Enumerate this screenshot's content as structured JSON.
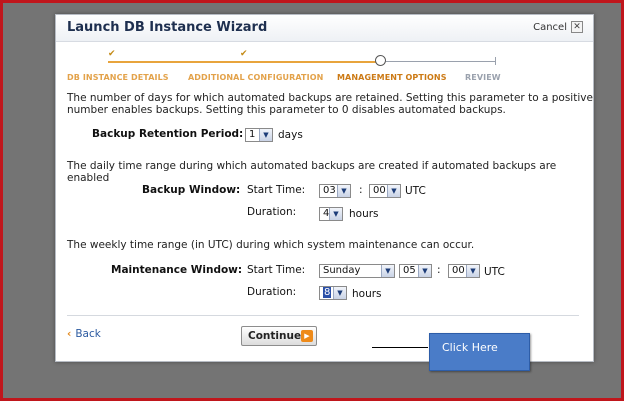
{
  "dialog": {
    "title": "Launch DB Instance Wizard",
    "cancel_label": "Cancel",
    "close_glyph": "✕"
  },
  "steps": [
    {
      "label": "DB INSTANCE DETAILS",
      "state": "done",
      "mark": "✔"
    },
    {
      "label": "ADDITIONAL CONFIGURATION",
      "state": "done",
      "mark": "✔"
    },
    {
      "label": "MANAGEMENT OPTIONS",
      "state": "current"
    },
    {
      "label": "REVIEW",
      "state": "future"
    }
  ],
  "backup": {
    "description_line1": "The number of days for which automated backups are retained. Setting this parameter to a positive",
    "description_line2": "number enables backups. Setting this parameter to 0 disables automated backups.",
    "retention_label": "Backup Retention Period:",
    "retention_value": "1",
    "retention_unit": "days"
  },
  "backup_window": {
    "description": "The daily time range during which automated backups are created if automated backups are enabled",
    "label": "Backup Window:",
    "start_label": "Start Time:",
    "start_hour": "03",
    "colon": ":",
    "start_minute": "00",
    "tz": "UTC",
    "duration_label": "Duration:",
    "duration_value": "4",
    "duration_unit": "hours"
  },
  "maintenance_window": {
    "description": "The weekly time range (in UTC) during which system maintenance can occur.",
    "label": "Maintenance Window:",
    "start_label": "Start Time:",
    "day": "Sunday",
    "hour": "05",
    "colon": ":",
    "minute": "00",
    "tz": "UTC",
    "duration_label": "Duration:",
    "duration_value": "8",
    "duration_unit": "hours"
  },
  "footer": {
    "back_glyph": "‹",
    "back_label": "Back",
    "continue_label": "Continue",
    "continue_glyph": "▶"
  },
  "callout": {
    "text": "Click Here"
  },
  "colors": {
    "border_accent": "#c0161c",
    "step_done": "#e3a24a",
    "link": "#2c5aa0",
    "callout": "#4a7cc8"
  },
  "icons": {
    "dropdown": "chevron-down-icon",
    "close": "close-icon",
    "continue": "arrow-right-icon"
  }
}
